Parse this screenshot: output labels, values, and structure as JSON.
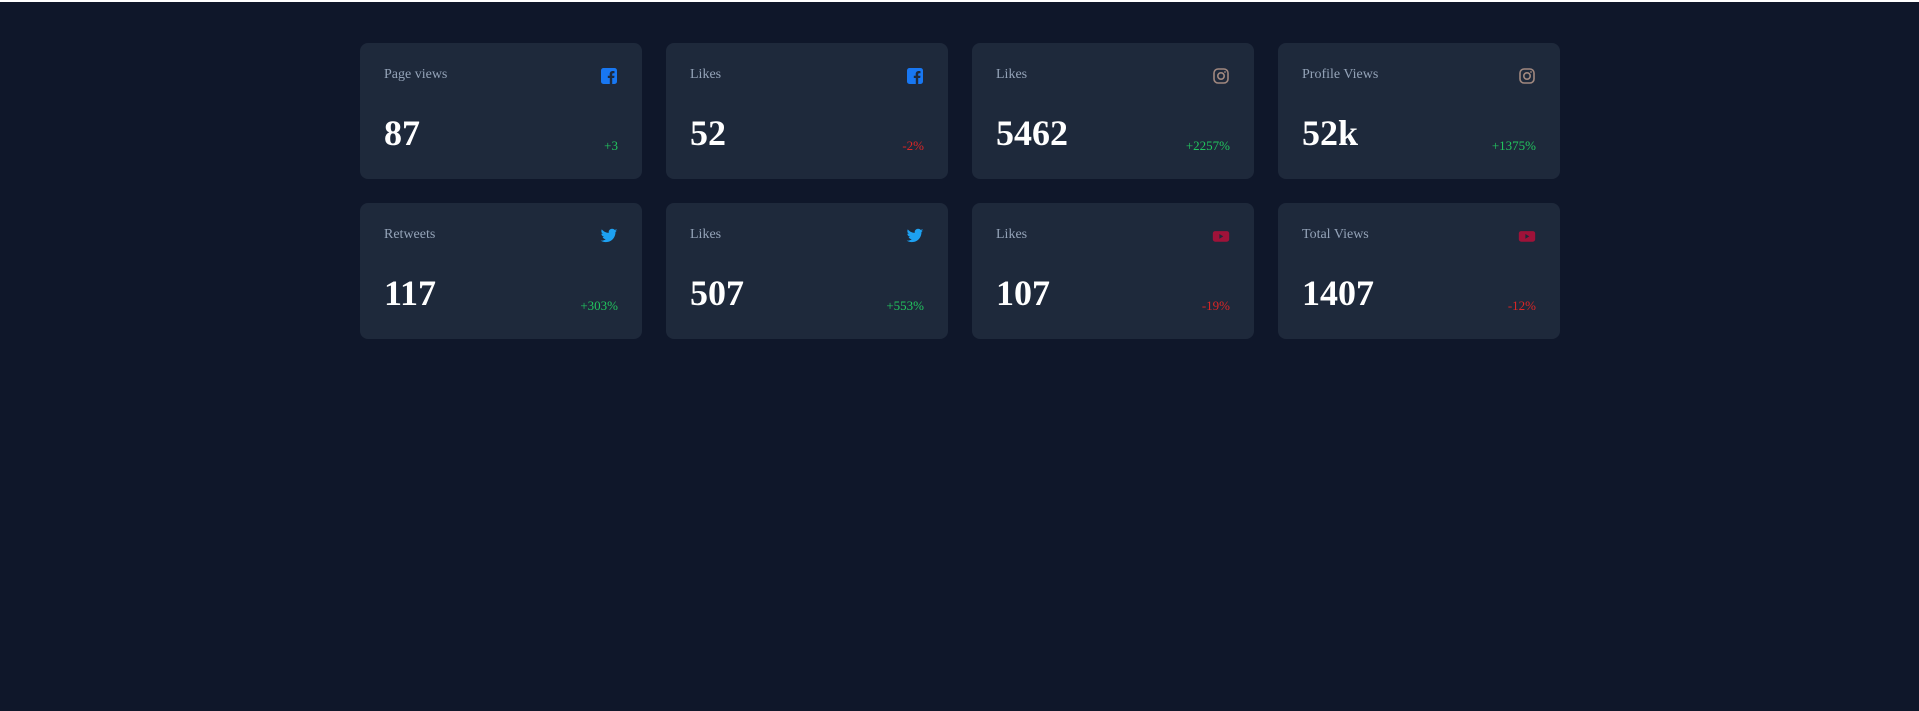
{
  "colors": {
    "background": "#0f172a",
    "card": "#1e293b",
    "positive": "#22c55e",
    "negative": "#dc2626",
    "facebook": "#1877f2",
    "instagram": "#a1887f",
    "twitter": "#1da1f2",
    "youtube": "#9f1239"
  },
  "cards": [
    {
      "label": "Page views",
      "icon": "facebook-icon",
      "value": "87",
      "change": "+3",
      "trend": "positive"
    },
    {
      "label": "Likes",
      "icon": "facebook-icon",
      "value": "52",
      "change": "-2%",
      "trend": "negative"
    },
    {
      "label": "Likes",
      "icon": "instagram-icon",
      "value": "5462",
      "change": "+2257%",
      "trend": "positive"
    },
    {
      "label": "Profile Views",
      "icon": "instagram-icon",
      "value": "52k",
      "change": "+1375%",
      "trend": "positive"
    },
    {
      "label": "Retweets",
      "icon": "twitter-icon",
      "value": "117",
      "change": "+303%",
      "trend": "positive"
    },
    {
      "label": "Likes",
      "icon": "twitter-icon",
      "value": "507",
      "change": "+553%",
      "trend": "positive"
    },
    {
      "label": "Likes",
      "icon": "youtube-icon",
      "value": "107",
      "change": "-19%",
      "trend": "negative"
    },
    {
      "label": "Total Views",
      "icon": "youtube-icon",
      "value": "1407",
      "change": "-12%",
      "trend": "negative"
    }
  ]
}
